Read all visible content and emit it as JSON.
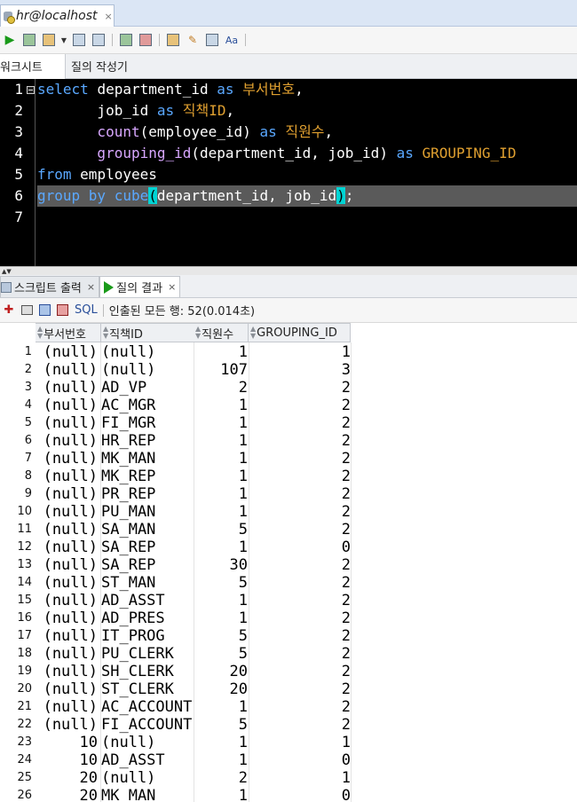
{
  "connection_tab": {
    "label": "hr@localhost",
    "close": "×"
  },
  "subtabs": {
    "worksheet": "워크시트",
    "query_builder": "질의 작성기"
  },
  "editor": {
    "line_numbers": [
      "1",
      "2",
      "3",
      "4",
      "5",
      "6",
      "7"
    ],
    "highlighted_line": 6,
    "lines": [
      [
        {
          "t": "select ",
          "c": "kw"
        },
        {
          "t": "department_id ",
          "c": ""
        },
        {
          "t": "as ",
          "c": "kw"
        },
        {
          "t": "부서번호",
          "c": "al"
        },
        {
          "t": ",",
          "c": ""
        }
      ],
      [
        {
          "t": "       job_id ",
          "c": ""
        },
        {
          "t": "as ",
          "c": "kw"
        },
        {
          "t": "직책ID",
          "c": "al"
        },
        {
          "t": ",",
          "c": ""
        }
      ],
      [
        {
          "t": "       count",
          "c": "fn"
        },
        {
          "t": "(employee_id) ",
          "c": ""
        },
        {
          "t": "as ",
          "c": "kw"
        },
        {
          "t": "직원수",
          "c": "al"
        },
        {
          "t": ",",
          "c": ""
        }
      ],
      [
        {
          "t": "       grouping_id",
          "c": "fn"
        },
        {
          "t": "(department_id, job_id) ",
          "c": ""
        },
        {
          "t": "as ",
          "c": "kw"
        },
        {
          "t": "GROUPING_ID",
          "c": "al"
        }
      ],
      [
        {
          "t": "from ",
          "c": "kw"
        },
        {
          "t": "employees",
          "c": ""
        }
      ],
      [
        {
          "t": "group by ",
          "c": "kw"
        },
        {
          "t": "cube",
          "c": "kw"
        },
        {
          "t": "(",
          "c": "br"
        },
        {
          "t": "department_id, job_id",
          "c": ""
        },
        {
          "t": ")",
          "c": "br"
        },
        {
          "t": ";",
          "c": ""
        }
      ],
      []
    ]
  },
  "output_tabs": {
    "script_output": "스크립트 출력",
    "query_result": "질의 결과",
    "close": "×"
  },
  "result_toolbar": {
    "sql_label": "SQL",
    "fetch_status": "인출된 모든 행: 52(0.014초)"
  },
  "grid": {
    "columns": [
      "부서번호",
      "직책ID",
      "직원수",
      "GROUPING_ID"
    ],
    "rows": [
      [
        "1",
        "(null)",
        "(null)",
        "1",
        "1"
      ],
      [
        "2",
        "(null)",
        "(null)",
        "107",
        "3"
      ],
      [
        "3",
        "(null)",
        "AD_VP",
        "2",
        "2"
      ],
      [
        "4",
        "(null)",
        "AC_MGR",
        "1",
        "2"
      ],
      [
        "5",
        "(null)",
        "FI_MGR",
        "1",
        "2"
      ],
      [
        "6",
        "(null)",
        "HR_REP",
        "1",
        "2"
      ],
      [
        "7",
        "(null)",
        "MK_MAN",
        "1",
        "2"
      ],
      [
        "8",
        "(null)",
        "MK_REP",
        "1",
        "2"
      ],
      [
        "9",
        "(null)",
        "PR_REP",
        "1",
        "2"
      ],
      [
        "10",
        "(null)",
        "PU_MAN",
        "1",
        "2"
      ],
      [
        "11",
        "(null)",
        "SA_MAN",
        "5",
        "2"
      ],
      [
        "12",
        "(null)",
        "SA_REP",
        "1",
        "0"
      ],
      [
        "13",
        "(null)",
        "SA_REP",
        "30",
        "2"
      ],
      [
        "14",
        "(null)",
        "ST_MAN",
        "5",
        "2"
      ],
      [
        "15",
        "(null)",
        "AD_ASST",
        "1",
        "2"
      ],
      [
        "16",
        "(null)",
        "AD_PRES",
        "1",
        "2"
      ],
      [
        "17",
        "(null)",
        "IT_PROG",
        "5",
        "2"
      ],
      [
        "18",
        "(null)",
        "PU_CLERK",
        "5",
        "2"
      ],
      [
        "19",
        "(null)",
        "SH_CLERK",
        "20",
        "2"
      ],
      [
        "20",
        "(null)",
        "ST_CLERK",
        "20",
        "2"
      ],
      [
        "21",
        "(null)",
        "AC_ACCOUNT",
        "1",
        "2"
      ],
      [
        "22",
        "(null)",
        "FI_ACCOUNT",
        "5",
        "2"
      ],
      [
        "23",
        "10",
        "(null)",
        "1",
        "1"
      ],
      [
        "24",
        "10",
        "AD_ASST",
        "1",
        "0"
      ],
      [
        "25",
        "20",
        "(null)",
        "2",
        "1"
      ],
      [
        "26",
        "20",
        "MK_MAN",
        "1",
        "0"
      ]
    ]
  }
}
